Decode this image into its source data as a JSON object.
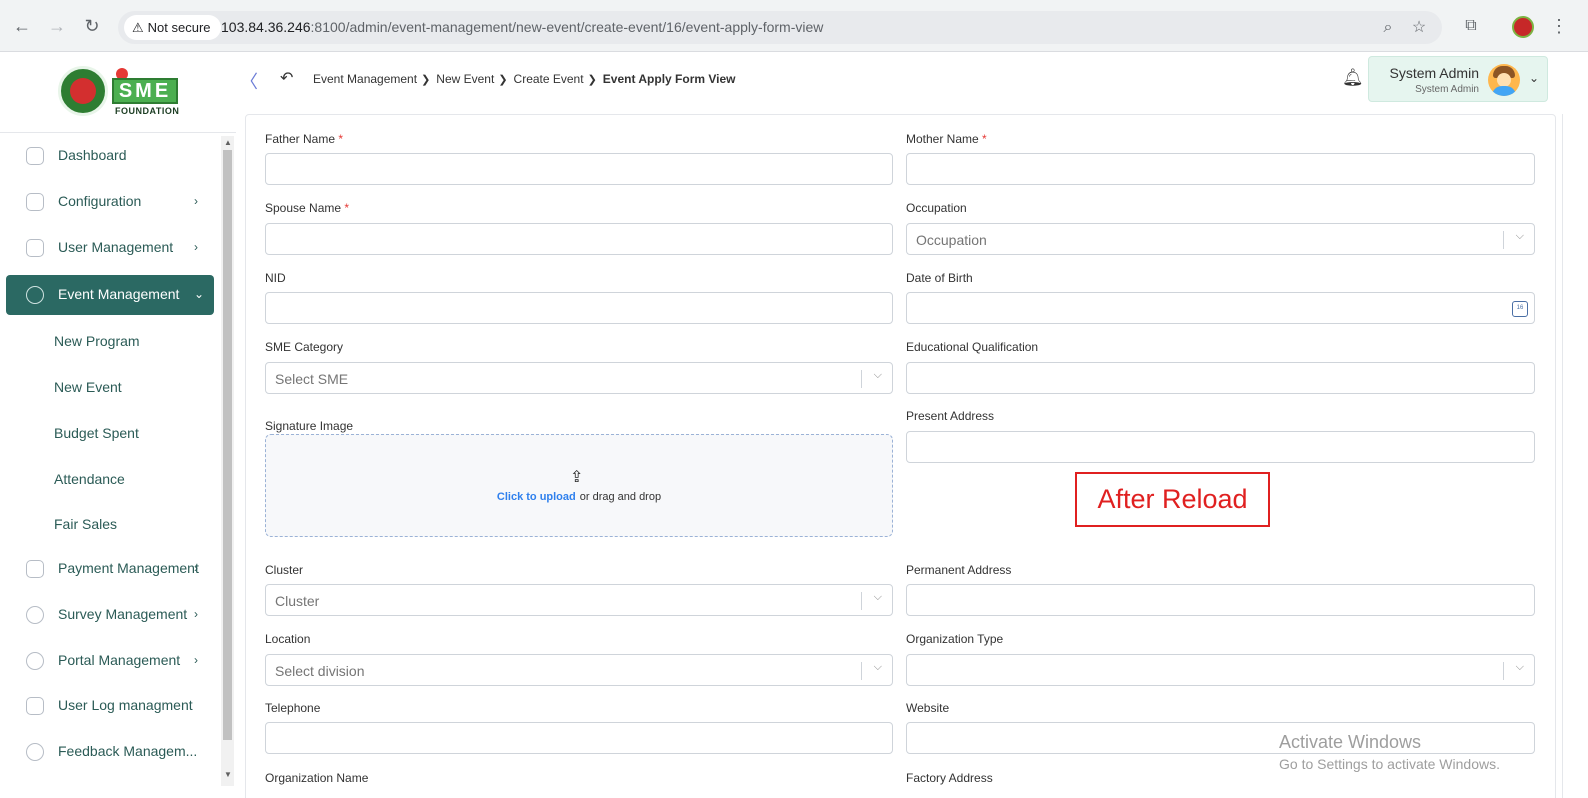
{
  "browser": {
    "security_label": "Not secure",
    "url_host": "103.84.36.246",
    "url_path": ":8100/admin/event-management/new-event/create-event/16/event-apply-form-view"
  },
  "logo": {
    "brand": "SME",
    "subtitle": "FOUNDATION"
  },
  "sidebar": {
    "items": [
      {
        "label": "Dashboard"
      },
      {
        "label": "Configuration"
      },
      {
        "label": "User Management"
      },
      {
        "label": "Event Management"
      },
      {
        "label": "Payment Management"
      },
      {
        "label": "Survey Management"
      },
      {
        "label": "Portal Management"
      },
      {
        "label": "User Log managment"
      },
      {
        "label": "Feedback Managem..."
      }
    ],
    "sub_items": [
      {
        "label": "New Program"
      },
      {
        "label": "New Event"
      },
      {
        "label": "Budget Spent"
      },
      {
        "label": "Attendance"
      },
      {
        "label": "Fair Sales"
      }
    ]
  },
  "breadcrumb": {
    "items": [
      "Event Management",
      "New Event",
      "Create Event"
    ],
    "current": "Event Apply Form View"
  },
  "user": {
    "name": "System Admin",
    "role": "System Admin"
  },
  "form": {
    "father_name": {
      "label": "Father Name",
      "required": "*"
    },
    "mother_name": {
      "label": "Mother Name",
      "required": "*"
    },
    "spouse_name": {
      "label": "Spouse Name",
      "required": "*"
    },
    "occupation": {
      "label": "Occupation",
      "placeholder": "Occupation"
    },
    "nid": {
      "label": "NID"
    },
    "date_of_birth": {
      "label": "Date of Birth",
      "icon_text": "16"
    },
    "sme_category": {
      "label": "SME Category",
      "placeholder": "Select SME"
    },
    "educational_qualification": {
      "label": "Educational Qualification"
    },
    "signature_image": {
      "label": "Signature Image",
      "link_text": "Click to upload",
      "rest_text": "or drag and drop"
    },
    "present_address": {
      "label": "Present Address"
    },
    "cluster": {
      "label": "Cluster",
      "placeholder": "Cluster"
    },
    "permanent_address": {
      "label": "Permanent Address"
    },
    "location": {
      "label": "Location",
      "placeholder": "Select division"
    },
    "organization_type": {
      "label": "Organization Type"
    },
    "telephone": {
      "label": "Telephone"
    },
    "website": {
      "label": "Website"
    },
    "organization_name": {
      "label": "Organization Name"
    },
    "factory_address": {
      "label": "Factory Address"
    }
  },
  "annotation": {
    "text": "After Reload",
    "color": "#e02020"
  },
  "watermark": {
    "line1": "Activate Windows",
    "line2": "Go to Settings to activate Windows."
  },
  "colors": {
    "sidebar_active": "#2b6963",
    "link": "#2f80ed",
    "required": "#e53935"
  }
}
